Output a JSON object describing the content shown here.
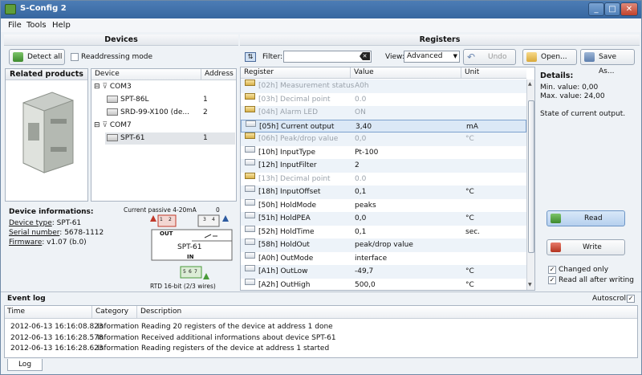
{
  "window": {
    "title": "S-Config 2",
    "minimize": "_",
    "maximize": "□",
    "close": "✕"
  },
  "menu": [
    "File",
    "Tools",
    "Help"
  ],
  "devices": {
    "header": "Devices",
    "detect_label": "Detect all",
    "readdressing_label": "Readdressing mode",
    "related_header": "Related products",
    "tree_columns": [
      "Device",
      "Address"
    ],
    "tree": [
      {
        "label": "COM3",
        "address": ""
      },
      {
        "label": "SPT-86L",
        "address": "1"
      },
      {
        "label": "SRD-99-X100 (de...",
        "address": "2"
      },
      {
        "label": "COM7",
        "address": ""
      },
      {
        "label": "SPT-61",
        "address": "1"
      }
    ],
    "info_title": "Device informations:",
    "info": [
      {
        "key": "Device type",
        "value": ": SPT-61"
      },
      {
        "key": "Serial number",
        "value": ": 5678-1112"
      },
      {
        "key": "Firmware",
        "value": ": v1.07 (b.0)"
      }
    ],
    "diagram": {
      "top_label": "Current passive 4-20mA",
      "top_right": "0",
      "out": "OUT",
      "name": "SPT-61",
      "in": "IN",
      "bottom_label": "RTD 16-bit (2/3 wires)",
      "terminals_top": [
        "1",
        "2",
        "3",
        "4"
      ],
      "terminals_bottom": [
        "5",
        "6",
        "7"
      ]
    }
  },
  "registers": {
    "header": "Registers",
    "filter_label": "Filter:",
    "filter_value": "",
    "view_label": "View:",
    "view_value": "Advanced",
    "undo_label": "Undo",
    "open_label": "Open...",
    "saveas_label": "Save As...",
    "columns": [
      "Register",
      "Value",
      "Unit"
    ],
    "rows": [
      {
        "register": "[02h] Measurement status",
        "value": "A0h",
        "unit": "",
        "readonly": true
      },
      {
        "register": "[03h] Decimal point",
        "value": "0.0",
        "unit": "",
        "readonly": true
      },
      {
        "register": "[04h] Alarm LED",
        "value": "ON",
        "unit": "",
        "readonly": true
      },
      {
        "register": "[05h] Current output",
        "value": "3,40",
        "unit": "mA",
        "readonly": false
      },
      {
        "register": "[06h] Peak/drop value",
        "value": "0,0",
        "unit": "°C",
        "readonly": true
      },
      {
        "register": "[10h] InputType",
        "value": "Pt-100",
        "unit": "",
        "readonly": false
      },
      {
        "register": "[12h] InputFilter",
        "value": "2",
        "unit": "",
        "readonly": false
      },
      {
        "register": "[13h] Decimal point",
        "value": "0.0",
        "unit": "",
        "readonly": true
      },
      {
        "register": "[18h] InputOffset",
        "value": "0,1",
        "unit": "°C",
        "readonly": false
      },
      {
        "register": "[50h] HoldMode",
        "value": "peaks",
        "unit": "",
        "readonly": false
      },
      {
        "register": "[51h] HoldPEA",
        "value": "0,0",
        "unit": "°C",
        "readonly": false
      },
      {
        "register": "[52h] HoldTime",
        "value": "0,1",
        "unit": "sec.",
        "readonly": false
      },
      {
        "register": "[58h] HoldOut",
        "value": "peak/drop value",
        "unit": "",
        "readonly": false
      },
      {
        "register": "[A0h] OutMode",
        "value": "interface",
        "unit": "",
        "readonly": false
      },
      {
        "register": "[A1h] OutLow",
        "value": "-49,7",
        "unit": "°C",
        "readonly": false
      },
      {
        "register": "[A2h] OutHigh",
        "value": "500,0",
        "unit": "°C",
        "readonly": false
      }
    ]
  },
  "details": {
    "title": "Details:",
    "min": "Min. value: 0,00",
    "max": "Max. value: 24,00",
    "description": "State of current output.",
    "read_label": "Read",
    "write_label": "Write",
    "changed_only": "Changed only",
    "read_all": "Read all after writing"
  },
  "eventlog": {
    "title": "Event log",
    "autoscroll": "Autoscroll",
    "columns": [
      "Time",
      "Category",
      "Description"
    ],
    "rows": [
      {
        "time": "2012-06-13 16:16:08.823",
        "category": "Information",
        "description": "Reading 20 registers of the device at address 1 done"
      },
      {
        "time": "2012-06-13 16:16:28.578",
        "category": "Information",
        "description": "Received additional informations about device SPT-61"
      },
      {
        "time": "2012-06-13 16:16:28.623",
        "category": "Information",
        "description": "Reading registers of the device at address 1 started"
      }
    ],
    "tab_label": "Log"
  },
  "colors": {
    "title_bar": "#3767a0",
    "selection": "#dbe8f6",
    "terminal_red": "#c0392b",
    "terminal_blue": "#2c5aa0",
    "terminal_green": "#4a9a3a"
  }
}
